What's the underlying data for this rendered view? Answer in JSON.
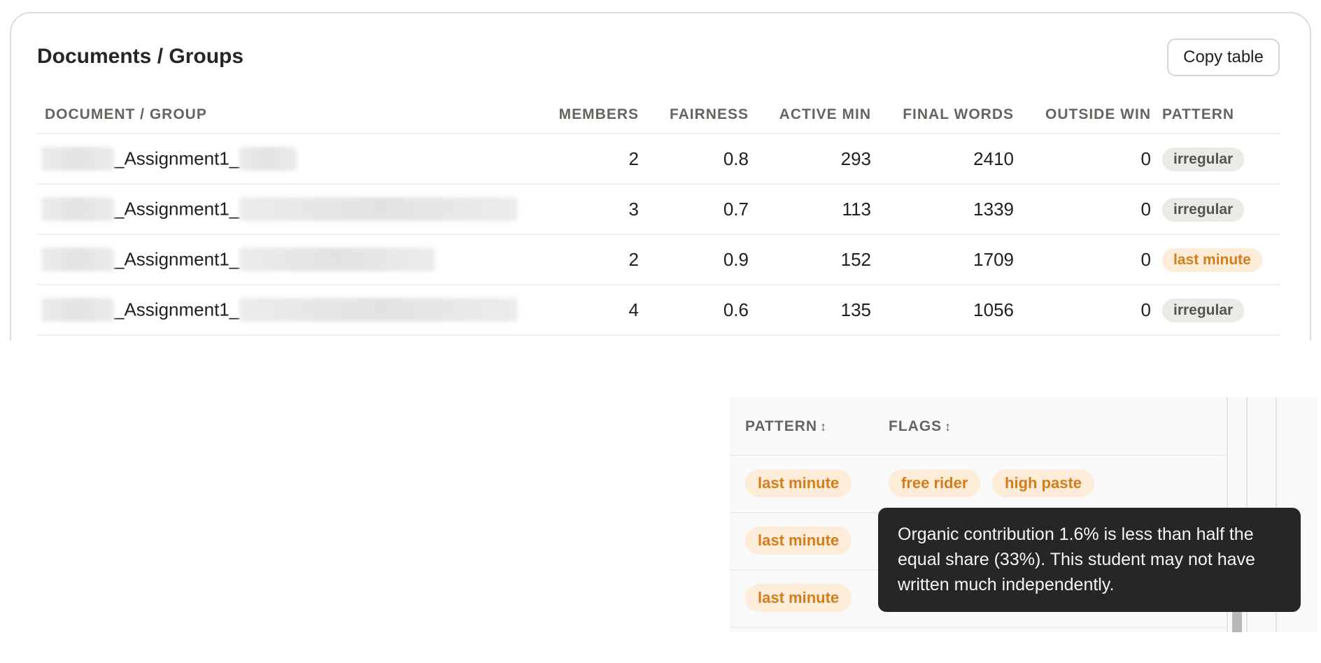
{
  "card": {
    "title": "Documents / Groups",
    "copy_label": "Copy table",
    "columns": {
      "document": "DOCUMENT / GROUP",
      "members": "MEMBERS",
      "fairness": "FAIRNESS",
      "active": "ACTIVE MIN",
      "words": "FINAL WORDS",
      "outside": "OUTSIDE WIN",
      "pattern": "PATTERN"
    },
    "rows": [
      {
        "name": "_Assignment1_",
        "members": "2",
        "fairness": "0.8",
        "active": "293",
        "words": "2410",
        "outside": "0",
        "pattern": "irregular"
      },
      {
        "name": "_Assignment1_",
        "members": "3",
        "fairness": "0.7",
        "active": "113",
        "words": "1339",
        "outside": "0",
        "pattern": "irregular"
      },
      {
        "name": "_Assignment1_",
        "members": "2",
        "fairness": "0.9",
        "active": "152",
        "words": "1709",
        "outside": "0",
        "pattern": "last minute"
      },
      {
        "name": "_Assignment1_",
        "members": "4",
        "fairness": "0.6",
        "active": "135",
        "words": "1056",
        "outside": "0",
        "pattern": "irregular"
      }
    ]
  },
  "panel": {
    "col_pattern": "PATTERN",
    "col_flags": "FLAGS",
    "sort_glyph": "↕",
    "rows": [
      {
        "pattern": "last minute",
        "flags": [
          "free rider",
          "high paste"
        ]
      },
      {
        "pattern": "last minute"
      },
      {
        "pattern": "last minute"
      }
    ]
  },
  "tooltip": {
    "text": "Organic contribution 1.6% is less than half the equal share (33%). This student may not have written much independently."
  },
  "colors": {
    "pill_gray_bg": "#ebeae5",
    "pill_orange_bg": "#fcecd8",
    "pill_orange_text": "#d27e1d",
    "tooltip_bg": "#262626"
  }
}
